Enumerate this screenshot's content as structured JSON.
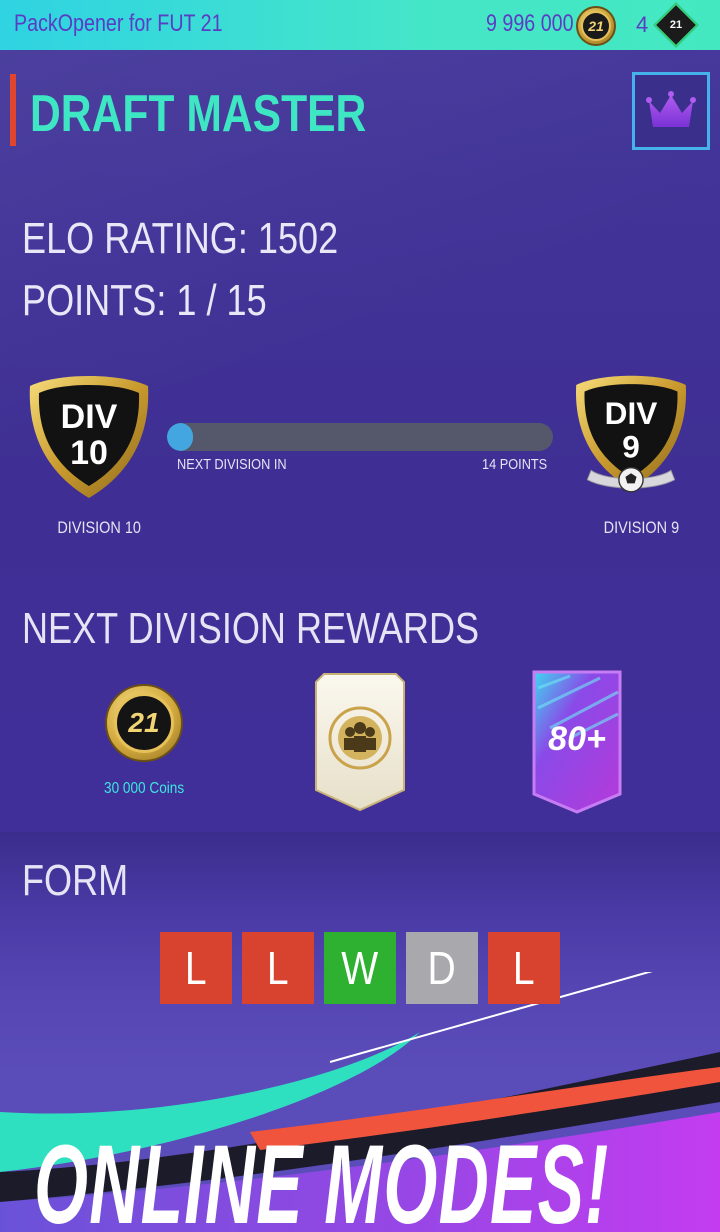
{
  "topbar": {
    "app_title": "PackOpener for FUT 21",
    "coins": "9 996 000",
    "coin_icon_text": "21",
    "points": "4",
    "points_icon_text": "21"
  },
  "header": {
    "title": "DRAFT MASTER",
    "crown_icon": "crown-icon"
  },
  "stats": {
    "elo": "ELO RATING: 1502",
    "points": "POINTS: 1 / 15"
  },
  "progress": {
    "current_badge": {
      "line1": "DIV",
      "line2": "10",
      "label": "DIVISION 10"
    },
    "next_badge": {
      "line1": "DIV",
      "line2": "9",
      "label": "DIVISION 9"
    },
    "fraction": 0.0667,
    "left_label": "NEXT DIVISION IN",
    "right_label": "14 POINTS"
  },
  "rewards": {
    "title": "NEXT DIVISION REWARDS",
    "coin_text": "21",
    "coin_label": "30 000 Coins",
    "card_text": "80+"
  },
  "form": {
    "title": "FORM",
    "results": [
      {
        "letter": "L",
        "color": "#d8432f"
      },
      {
        "letter": "L",
        "color": "#d8432f"
      },
      {
        "letter": "W",
        "color": "#2eb030"
      },
      {
        "letter": "D",
        "color": "#a9a8ad"
      },
      {
        "letter": "L",
        "color": "#d8432f"
      }
    ]
  },
  "banner": {
    "text": "ONLINE MODES!"
  },
  "colors": {
    "accent_teal": "#3ee6c3",
    "accent_red": "#e0452e",
    "panel": "#3f2f94",
    "progress_fill": "#43a6e0"
  }
}
